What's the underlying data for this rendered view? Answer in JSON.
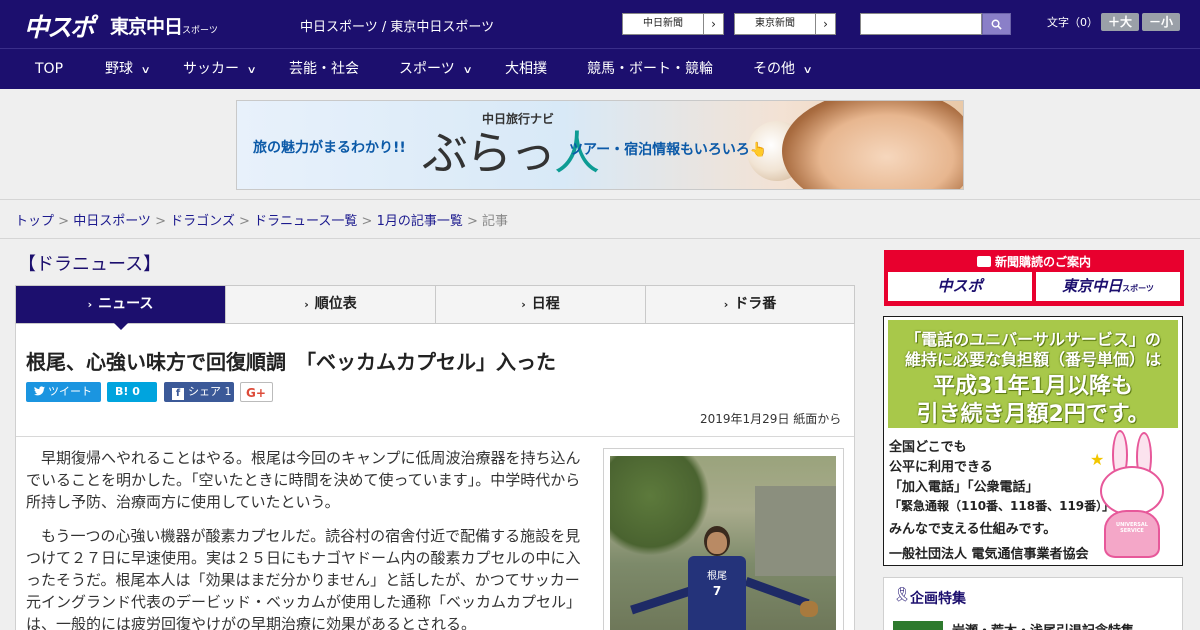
{
  "header": {
    "logo_main": "中スポ",
    "logo_tokyo": "東京中日",
    "logo_tokyo_small": "スポーツ",
    "site_name": "中日スポーツ / 東京中日スポーツ",
    "ext_links": [
      {
        "label": "中日新聞",
        "arrow": "›"
      },
      {
        "label": "東京新聞",
        "arrow": "›"
      }
    ],
    "search_placeholder": "",
    "search_icon": "search-icon",
    "text_size_label": "文字（0）",
    "text_size_up": "＋大",
    "text_size_down": "－小"
  },
  "nav": {
    "items": [
      {
        "label": "TOP",
        "has_menu": false
      },
      {
        "label": "野球",
        "has_menu": true
      },
      {
        "label": "サッカー",
        "has_menu": true
      },
      {
        "label": "芸能・社会",
        "has_menu": false
      },
      {
        "label": "スポーツ",
        "has_menu": true
      },
      {
        "label": "大相撲",
        "has_menu": false
      },
      {
        "label": "競馬・ボート・競輪",
        "has_menu": false
      },
      {
        "label": "その他",
        "has_menu": true
      }
    ],
    "chevron": "∨"
  },
  "banner": {
    "left_text": "旅の魅力がまるわかり!!",
    "brand": "中日旅行ナビ",
    "title_a": "ぶらっ",
    "title_b": "人",
    "right_text": "ツアー・宿泊情報もいろいろ👆"
  },
  "breadcrumb": {
    "links": [
      "トップ",
      "中日スポーツ",
      "ドラゴンズ",
      "ドラニュース一覧",
      "1月の記事一覧"
    ],
    "current": "記事",
    "separator": " > "
  },
  "section": {
    "title": "【ドラニュース】"
  },
  "tabs": [
    {
      "label": "ニュース",
      "active": true
    },
    {
      "label": "順位表",
      "active": false
    },
    {
      "label": "日程",
      "active": false
    },
    {
      "label": "ドラ番",
      "active": false
    }
  ],
  "tab_icon": "›",
  "article": {
    "headline": "根尾、心強い味方で回復順調　「ベッカムカプセル」入った",
    "share": {
      "tweet": "ツイート",
      "hatena": "B! 0",
      "facebook": "シェア 1",
      "gplus": "G+"
    },
    "dateline": "2019年1月29日 紙面から",
    "paragraphs": [
      "早期復帰へやれることはやる。根尾は今回のキャンプに低周波治療器を持ち込んでいることを明かした。「空いたときに時間を決めて使っています」。中学時代から所持し予防、治療両方に使用していたという。",
      "もう一つの心強い機器が酸素カプセルだ。読谷村の宿舎付近で配備する施設を見つけて２７日に早速使用。実は２５日にもナゴヤドーム内の酸素カプセルの中に入ったそうだ。根尾本人は「効果はまだ分かりません」と話したが、かつてサッカー元イングランド代表のデービッド・ベッカムが使用した通称「ベッカムカプセル」は、一般的には疲労回復やけがの早期治療に効果があるとされる。"
    ],
    "photo_jersey": "根尾",
    "photo_number": "7"
  },
  "sidebar": {
    "subscribe_title": "新聞購読のご案内",
    "subscribe_icon": "newspaper-icon",
    "subscribe_a": "中スポ",
    "subscribe_b": "東京中日",
    "subscribe_b_small": "スポーツ",
    "ad_line1": "「電話のユニバーサルサービス」の",
    "ad_line2": "維持に必要な負担額（番号単価）は",
    "ad_line3": "平成31年1月以降も",
    "ad_line4": "引き続き月額2円です。",
    "ad_body": [
      "全国どこでも",
      "公平に利用できる",
      "「加入電話」「公衆電話」",
      "「緊急通報（110番、118番、119番）」を",
      "みんなで支える仕組みです。"
    ],
    "ad_footer": "一般社団法人 電気通信事業者協会",
    "ad_bunny_label": "UNIVERSAL SERVICE",
    "feature_title": "企画特集",
    "feature_item": "岩瀬・荒木・浅尾引退記念特集"
  },
  "colors": {
    "brand_navy": "#1c0f6e",
    "subscribe_red": "#e8002e",
    "ad_green": "#a8c84a",
    "twitter": "#1b95e0",
    "hatena": "#00a4de",
    "facebook": "#3b5998"
  }
}
